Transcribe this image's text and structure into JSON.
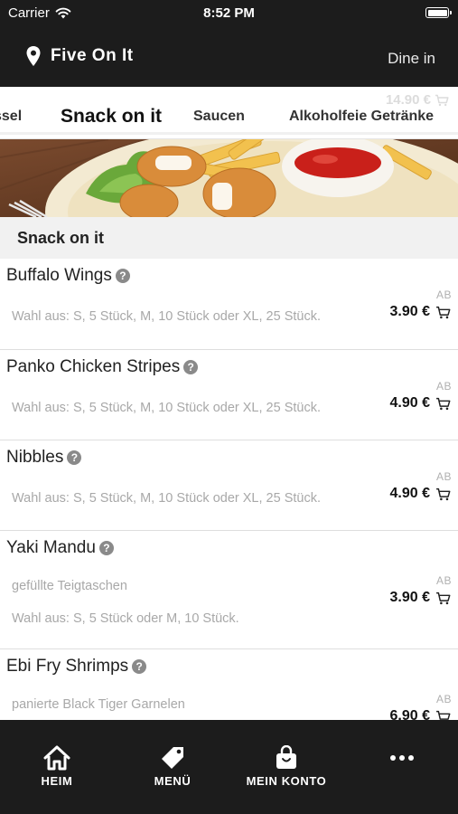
{
  "status_bar": {
    "carrier": "Carrier",
    "time": "8:52 PM"
  },
  "header": {
    "restaurant_name": "Five On It",
    "dine_mode": "Dine in"
  },
  "cart_preview": "14.90 €",
  "category_tabs": [
    {
      "label": "ssel",
      "active": false
    },
    {
      "label": "Snack on it",
      "active": true
    },
    {
      "label": "Saucen",
      "active": false
    },
    {
      "label": "Alkoholfeie Getränke",
      "active": false
    }
  ],
  "section_title": "Snack on it",
  "items": [
    {
      "name": "Buffalo Wings",
      "descriptions": [
        "Wahl aus: S, 5 Stück, M, 10 Stück oder XL, 25 Stück."
      ],
      "price_prefix": "AB",
      "price": "3.90 €"
    },
    {
      "name": "Panko Chicken Stripes",
      "descriptions": [
        "Wahl aus: S, 5 Stück, M, 10 Stück oder XL, 25 Stück."
      ],
      "price_prefix": "AB",
      "price": "4.90 €"
    },
    {
      "name": "Nibbles",
      "descriptions": [
        "Wahl aus: S, 5 Stück, M, 10 Stück oder XL, 25 Stück."
      ],
      "price_prefix": "AB",
      "price": "4.90 €"
    },
    {
      "name": "Yaki Mandu",
      "descriptions": [
        "gefüllte Teigtaschen",
        "Wahl aus: S, 5 Stück oder M, 10 Stück."
      ],
      "price_prefix": "AB",
      "price": "3.90 €"
    },
    {
      "name": "Ebi Fry Shrimps",
      "descriptions": [
        "panierte Black Tiger Garnelen"
      ],
      "price_prefix": "AB",
      "price": "6.90 €"
    }
  ],
  "bottom_nav": {
    "home": "HEIM",
    "menu": "MENÜ",
    "account": "MEIN KONTO",
    "more": ""
  },
  "colors": {
    "bar_background": "#1c1c1c",
    "section_background": "#f1f1f1",
    "description_text": "#a8a8a8"
  },
  "icons": {
    "location": "location-pin-icon",
    "cart": "cart-icon",
    "help": "question-circle-icon",
    "home": "home-icon",
    "menu": "tag-icon",
    "account": "shopping-bag-icon",
    "more": "more-dots-icon"
  }
}
